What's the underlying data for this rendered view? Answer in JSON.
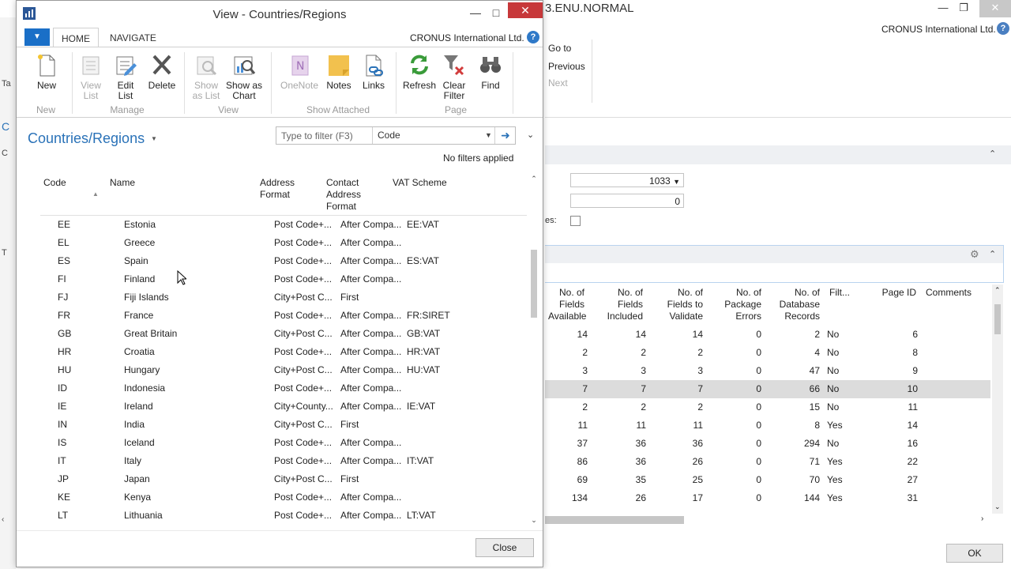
{
  "background_window": {
    "title_fragment": "3.ENU.NORMAL",
    "company": "CRONUS International Ltd.",
    "ribbon_items": [
      {
        "label": "Go to",
        "enabled": true
      },
      {
        "label": "Previous",
        "enabled": true
      },
      {
        "label": "Next",
        "enabled": false
      }
    ],
    "field1_value": "1033",
    "field2_value": "0",
    "checkbox_label_fragment": "es:",
    "left_tabs": [
      "Ta",
      "C",
      "C",
      "T"
    ],
    "ok_label": "OK",
    "columns": [
      "No. of\nFields\nAvailable",
      "No. of\nFields\nIncluded",
      "No. of\nFields to\nValidate",
      "No. of\nPackage\nErrors",
      "No. of\nDatabase\nRecords",
      "Filt...",
      "Page ID",
      "Comments"
    ],
    "rows": [
      [
        "14",
        "14",
        "14",
        "0",
        "2",
        "No",
        "6"
      ],
      [
        "2",
        "2",
        "2",
        "0",
        "4",
        "No",
        "8"
      ],
      [
        "3",
        "3",
        "3",
        "0",
        "47",
        "No",
        "9"
      ],
      [
        "7",
        "7",
        "7",
        "0",
        "66",
        "No",
        "10"
      ],
      [
        "2",
        "2",
        "2",
        "0",
        "15",
        "No",
        "11"
      ],
      [
        "11",
        "11",
        "11",
        "0",
        "8",
        "Yes",
        "14"
      ],
      [
        "37",
        "36",
        "36",
        "0",
        "294",
        "No",
        "16"
      ],
      [
        "86",
        "36",
        "26",
        "0",
        "71",
        "Yes",
        "22"
      ],
      [
        "69",
        "35",
        "25",
        "0",
        "70",
        "Yes",
        "27"
      ],
      [
        "134",
        "26",
        "17",
        "0",
        "144",
        "Yes",
        "31"
      ]
    ],
    "selected_row": 3
  },
  "dialog": {
    "title": "View - Countries/Regions",
    "tabs": [
      "HOME",
      "NAVIGATE"
    ],
    "active_tab": "HOME",
    "company": "CRONUS International Ltd.",
    "help": "?",
    "ribbon": {
      "buttons": [
        {
          "id": "new",
          "label": "New",
          "enabled": true
        },
        {
          "id": "view-list",
          "label": "View\nList",
          "enabled": false
        },
        {
          "id": "edit-list",
          "label": "Edit\nList",
          "enabled": true
        },
        {
          "id": "delete",
          "label": "Delete",
          "enabled": true
        },
        {
          "id": "show-as-list",
          "label": "Show\nas List",
          "enabled": false
        },
        {
          "id": "show-as-chart",
          "label": "Show as\nChart",
          "enabled": true
        },
        {
          "id": "onenote",
          "label": "OneNote",
          "enabled": false
        },
        {
          "id": "notes",
          "label": "Notes",
          "enabled": true
        },
        {
          "id": "links",
          "label": "Links",
          "enabled": true
        },
        {
          "id": "refresh",
          "label": "Refresh",
          "enabled": true
        },
        {
          "id": "clear-filter",
          "label": "Clear\nFilter",
          "enabled": true
        },
        {
          "id": "find",
          "label": "Find",
          "enabled": true
        }
      ],
      "groups": [
        "New",
        "Manage",
        "View",
        "Show Attached",
        "Page"
      ]
    },
    "list_title": "Countries/Regions",
    "filter": {
      "placeholder": "Type to filter (F3)",
      "field": "Code"
    },
    "no_filters": "No filters applied",
    "columns": [
      "Code",
      "Name",
      "Address\nFormat",
      "Contact\nAddress\nFormat",
      "VAT Scheme"
    ],
    "rows": [
      [
        "EE",
        "Estonia",
        "Post Code+...",
        "After Compa...",
        "EE:VAT"
      ],
      [
        "EL",
        "Greece",
        "Post Code+...",
        "After Compa...",
        ""
      ],
      [
        "ES",
        "Spain",
        "Post Code+...",
        "After Compa...",
        "ES:VAT"
      ],
      [
        "FI",
        "Finland",
        "Post Code+...",
        "After Compa...",
        ""
      ],
      [
        "FJ",
        "Fiji Islands",
        "City+Post C...",
        "First",
        ""
      ],
      [
        "FR",
        "France",
        "Post Code+...",
        "After Compa...",
        "FR:SIRET"
      ],
      [
        "GB",
        "Great Britain",
        "City+Post C...",
        "After Compa...",
        "GB:VAT"
      ],
      [
        "HR",
        "Croatia",
        "Post Code+...",
        "After Compa...",
        "HR:VAT"
      ],
      [
        "HU",
        "Hungary",
        "City+Post C...",
        "After Compa...",
        "HU:VAT"
      ],
      [
        "ID",
        "Indonesia",
        "Post Code+...",
        "After Compa...",
        ""
      ],
      [
        "IE",
        "Ireland",
        "City+County...",
        "After Compa...",
        "IE:VAT"
      ],
      [
        "IN",
        "India",
        "City+Post C...",
        "First",
        ""
      ],
      [
        "IS",
        "Iceland",
        "Post Code+...",
        "After Compa...",
        ""
      ],
      [
        "IT",
        "Italy",
        "Post Code+...",
        "After Compa...",
        "IT:VAT"
      ],
      [
        "JP",
        "Japan",
        "City+Post C...",
        "First",
        ""
      ],
      [
        "KE",
        "Kenya",
        "Post Code+...",
        "After Compa...",
        ""
      ],
      [
        "LT",
        "Lithuania",
        "Post Code+...",
        "After Compa...",
        "LT:VAT"
      ]
    ],
    "close_label": "Close"
  }
}
